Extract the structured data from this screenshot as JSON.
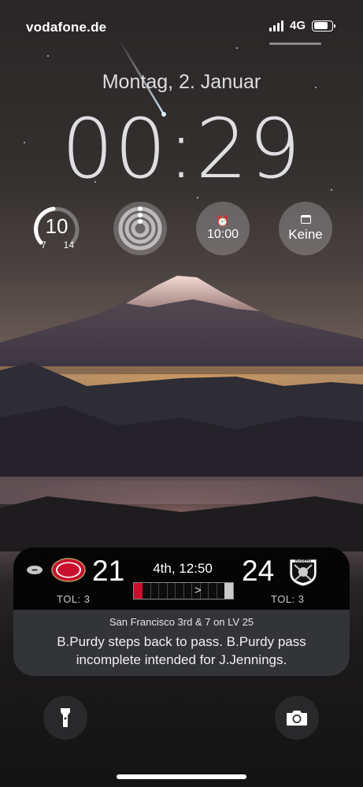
{
  "status_bar": {
    "carrier": "vodafone.de",
    "network": "4G",
    "signal_bars": 4,
    "battery_level": 0.8
  },
  "lock": {
    "date": "Montag, 2. Januar",
    "time": "00:29"
  },
  "widgets": {
    "weather": {
      "current": "10",
      "low": "7",
      "high": "14",
      "icon": "temperature-gauge"
    },
    "activity": {
      "icon": "activity-rings-icon"
    },
    "alarm": {
      "icon": "alarm-clock-icon",
      "time": "10:00"
    },
    "calendar": {
      "icon": "calendar-icon",
      "label": "Keine"
    }
  },
  "live_activity": {
    "home_team": {
      "abbr": "SF",
      "score": "21",
      "timeouts": "TOL: 3",
      "color": "#c8102e"
    },
    "away_team": {
      "abbr": "RAIDERS",
      "score": "24",
      "timeouts": "TOL: 3",
      "color": "#c9c9c9"
    },
    "clock": "4th, 12:50",
    "situation": "San Francisco 3rd & 7 on LV 25",
    "last_play": "B.Purdy steps back to pass. B.Purdy pass incomplete intended for J.Jennings."
  },
  "actions": {
    "flashlight": "flashlight-icon",
    "camera": "camera-icon"
  }
}
